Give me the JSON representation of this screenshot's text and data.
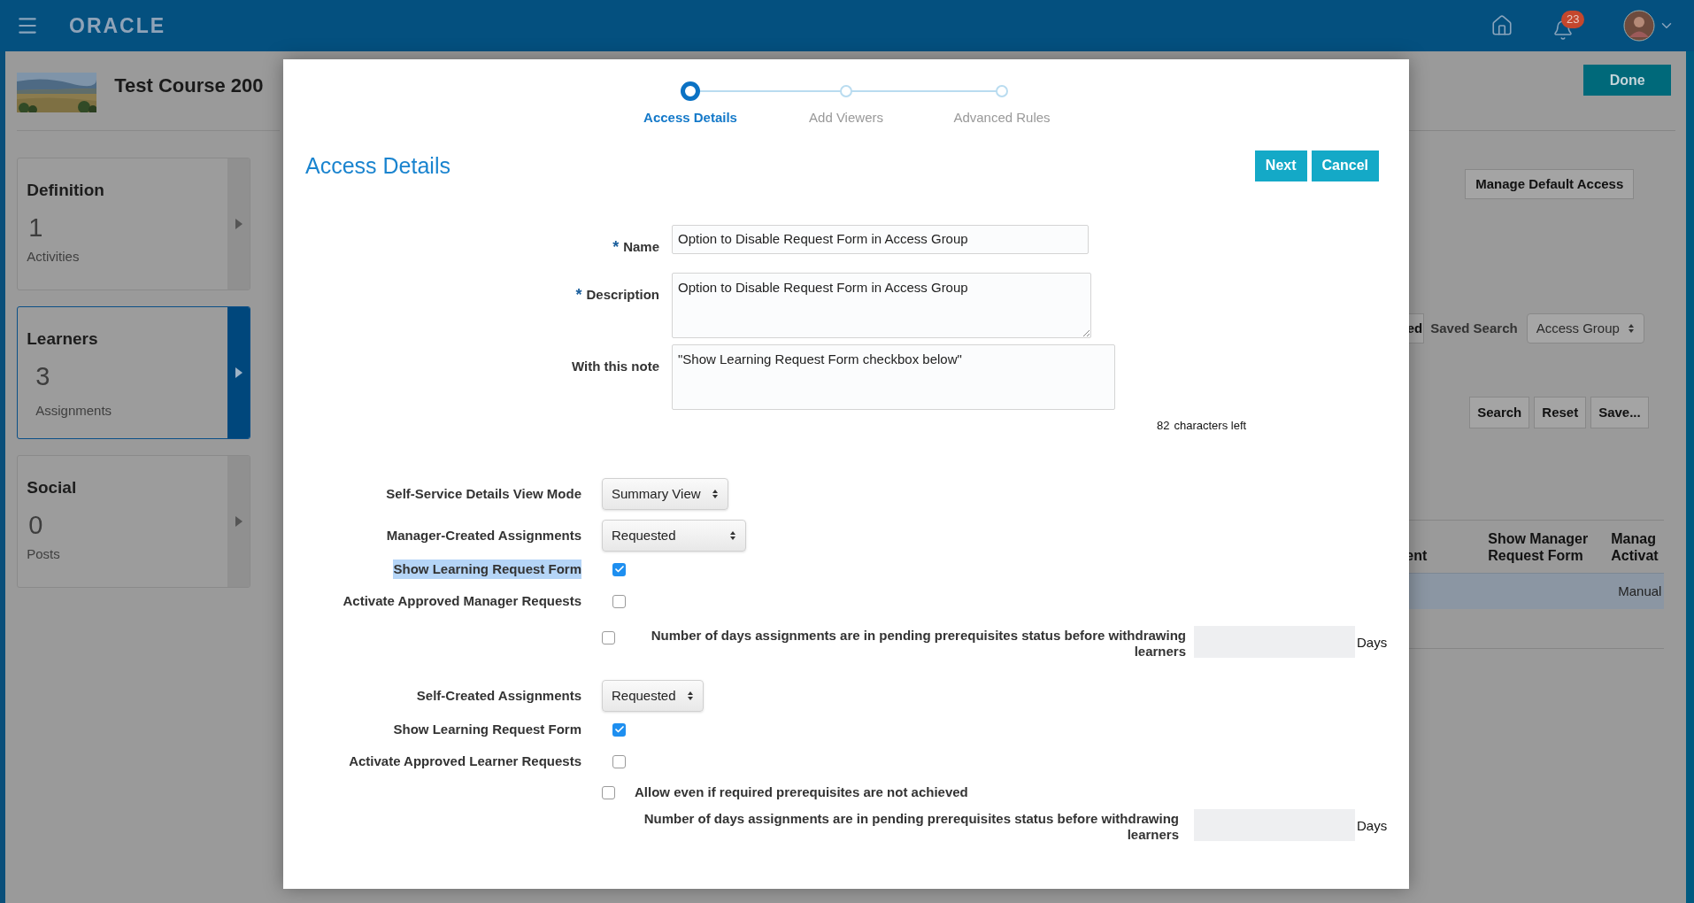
{
  "top_bar": {
    "logo": "ORACLE",
    "notification_count": "23"
  },
  "course": {
    "title": "Test Course 200"
  },
  "nav_cards": [
    {
      "title": "Definition",
      "count": "1",
      "label": "Activities",
      "selected": false
    },
    {
      "title": "Learners",
      "count": "3",
      "label": "Assignments",
      "selected": true
    },
    {
      "title": "Social",
      "count": "0",
      "label": "Posts",
      "selected": false
    }
  ],
  "background_page": {
    "done_button": "Done",
    "manage_button": "Manage Default Access",
    "partial_button": "ed",
    "saved_search_label": "Saved Search",
    "saved_search_value": "Access Group",
    "search_buttons": [
      "Search",
      "Reset",
      "Save..."
    ],
    "table": {
      "columns": [
        "ent",
        "Show Manager Request Form",
        "Manag Activat"
      ],
      "rows": [
        [
          null,
          null,
          "Manual"
        ]
      ]
    }
  },
  "dialog": {
    "steps": [
      {
        "label": "Access Details",
        "selected": true
      },
      {
        "label": "Add Viewers",
        "selected": false
      },
      {
        "label": "Advanced Rules",
        "selected": false
      }
    ],
    "title": "Access Details",
    "buttons": [
      "Next",
      "Cancel"
    ],
    "fields": [
      {
        "label": "Name",
        "marker": "*",
        "kind": "input",
        "value": "Option to Disable Request Form in Access Group"
      },
      {
        "label": "Description",
        "marker": "*",
        "kind": "textarea",
        "resizable": true,
        "value": "Option to Disable Request Form in Access Group"
      },
      {
        "label": "With this note",
        "kind": "textarea",
        "resizable": false,
        "value": "\"Show Learning Request Form checkbox below\""
      }
    ],
    "chars_left": "82",
    "chars_left_label": "characters left",
    "settings": [
      {
        "kind": "select",
        "label": "Self-Service Details View Mode",
        "value": "Summary View",
        "wide": false
      },
      {
        "kind": "select",
        "label": "Manager-Created Assignments",
        "value": "Requested",
        "wide": true
      },
      {
        "kind": "checkbox",
        "label": "Show Learning Request Form",
        "checked": true,
        "highlighted": true
      },
      {
        "kind": "checkbox",
        "label": "Activate Approved Manager Requests",
        "checked": false,
        "highlighted": false
      },
      {
        "kind": "days",
        "checked": false,
        "label": "Number of days assignments are in pending prerequisites status before withdrawing learners",
        "unit": "Days"
      },
      {
        "kind": "select",
        "label": "Self-Created Assignments",
        "value": "Requested",
        "wide": false
      },
      {
        "kind": "checkbox",
        "label": "Show Learning Request Form",
        "checked": true,
        "highlighted": false
      },
      {
        "kind": "checkbox",
        "label": "Activate Approved Learner Requests",
        "checked": false,
        "highlighted": false
      },
      {
        "kind": "option",
        "label": "Allow even if required prerequisites are not achieved",
        "checked": false
      },
      {
        "kind": "days",
        "label": "Number of days assignments are in pending prerequisites status before withdrawing learners",
        "unit": "Days"
      }
    ]
  }
}
